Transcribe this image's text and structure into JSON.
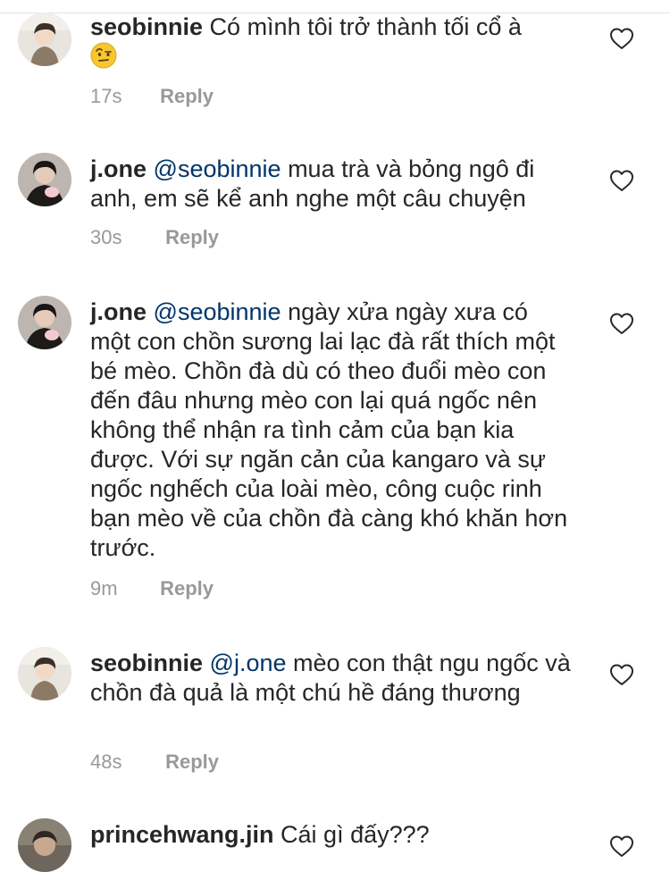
{
  "comments": [
    {
      "username": "seobinnie",
      "mention": "",
      "text": "Có mình tôi trở thành tối cổ à",
      "emoji": "face-with-raised-eyebrow",
      "time": "17s",
      "reply": "Reply",
      "avatar": "seobinnie-avatar"
    },
    {
      "username": "j.one",
      "mention": "@seobinnie",
      "text": "mua trà và bỏng ngô đi anh, em sẽ kể anh nghe một câu chuyện",
      "time": "30s",
      "reply": "Reply",
      "avatar": "j-one-avatar"
    },
    {
      "username": "j.one",
      "mention": "@seobinnie",
      "text": "ngày xửa ngày xưa có một con chồn sương lai lạc đà rất thích một bé mèo. Chồn đà dù có theo đuổi mèo con đến đâu nhưng mèo con lại quá ngốc nên không thể nhận ra tình cảm của bạn kia được. Với sự ngăn cản của kangaro và sự ngốc nghếch của loài mèo, công cuộc rinh bạn mèo về của chồn đà càng khó khăn hơn trước.",
      "time": "9m",
      "reply": "Reply",
      "avatar": "j-one-avatar"
    },
    {
      "username": "seobinnie",
      "mention": "@j.one",
      "text": "mèo con thật ngu ngốc và chồn đà quả là một chú hề đáng thương",
      "time": "48s",
      "reply": "Reply",
      "avatar": "seobinnie-avatar"
    },
    {
      "username": "princehwang.jin",
      "mention": "",
      "text": "Cái gì đấy???",
      "time": "",
      "reply": "",
      "avatar": "princehwang-jin-avatar"
    }
  ],
  "icons": {
    "like": "heart-outline-icon",
    "emoji": "raised-eyebrow-emoji-icon"
  },
  "colors": {
    "text": "#262626",
    "mention": "#003569",
    "meta": "#999999",
    "icon": "#262626"
  }
}
